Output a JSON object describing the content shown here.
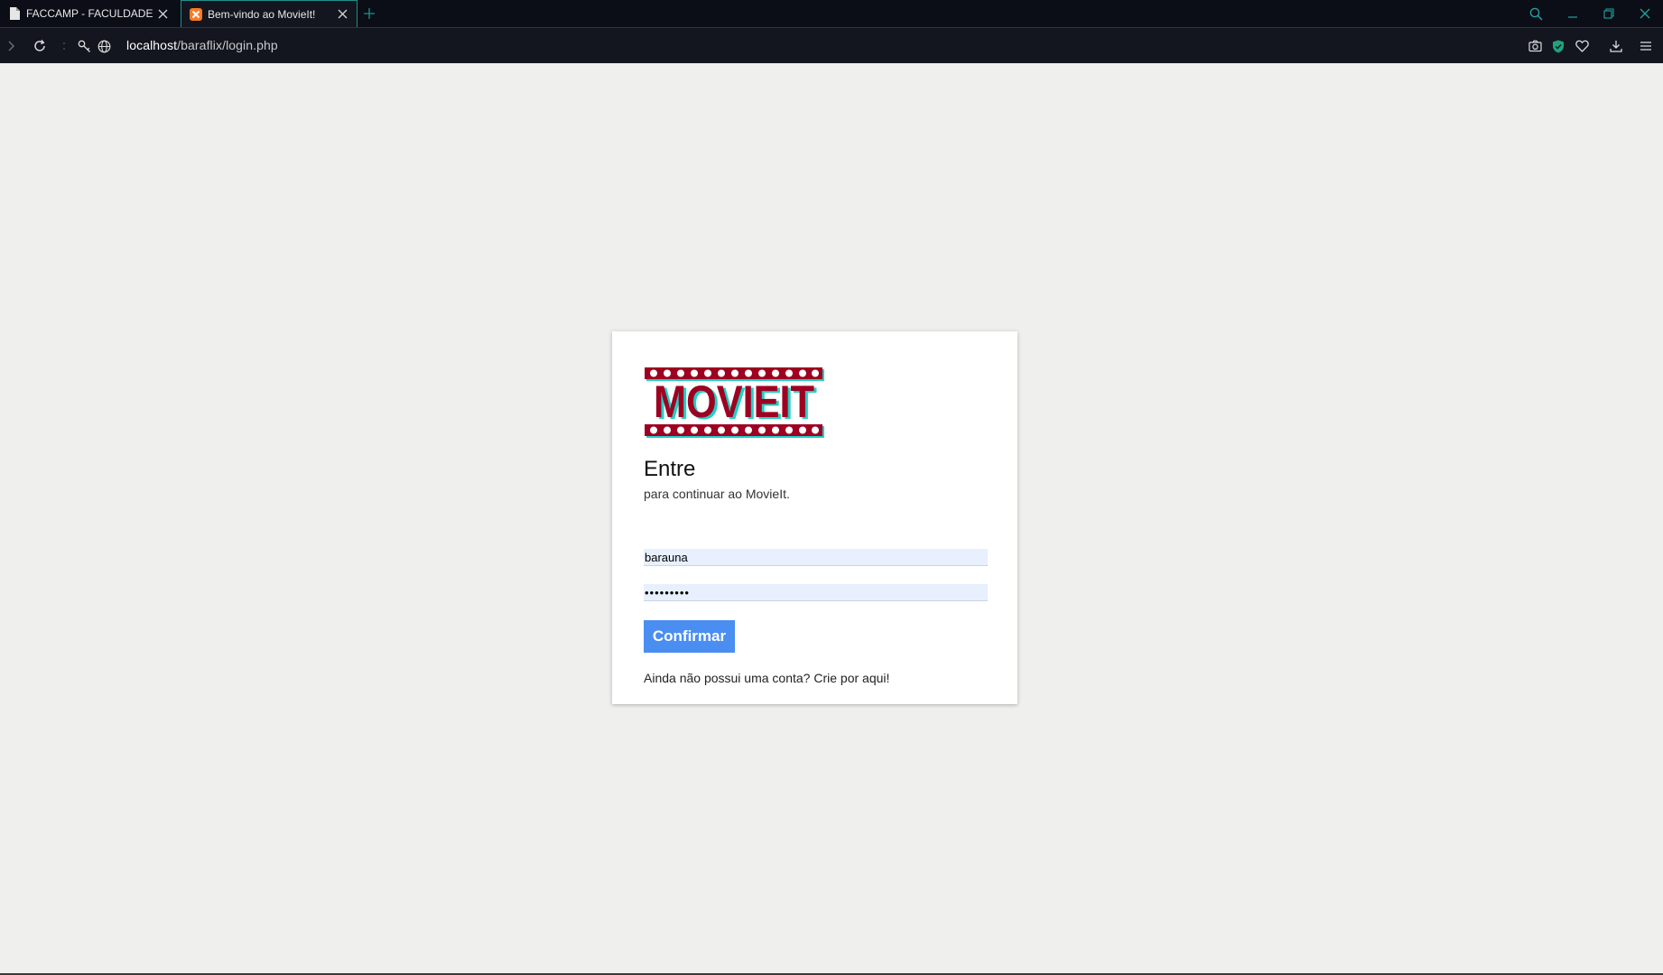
{
  "browser": {
    "tabs": [
      {
        "title": "FACCAMP - FACULDADE C/",
        "icon": "document-icon",
        "active": false
      },
      {
        "title": "Bem-vindo ao MovieIt!",
        "icon": "xampp-icon",
        "active": true
      }
    ],
    "url_host": "localhost",
    "url_path": "/baraflix/login.php",
    "accent_color": "#1f8f8c"
  },
  "login": {
    "logo_text": "MOVIEIT",
    "title": "Entre",
    "subtitle": "para continuar ao MovieIt.",
    "username_value": "barauna",
    "password_value": "•••••••••",
    "submit_label": "Confirmar",
    "signup_text": "Ainda não possui uma conta? Crie por aqui!",
    "button_color": "#4b8ef2",
    "field_bg": "#e8f0fe"
  }
}
